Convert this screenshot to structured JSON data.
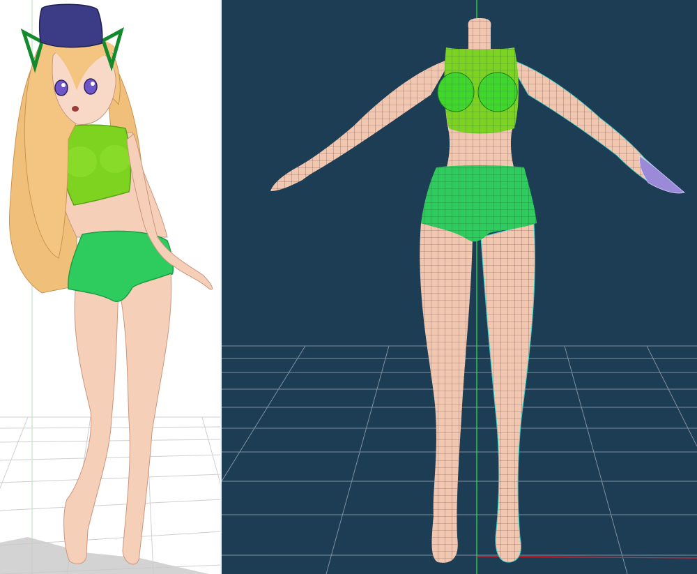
{
  "colors": {
    "left_background": "#ffffff",
    "viewport_background": "#1d3d55",
    "skin": "#f2c7b0",
    "top_green": "#7ed321",
    "shorts_green": "#2ecc5e",
    "hat_navy": "#3b3b86",
    "hair_blonde": "#f0c07a",
    "wireframe_cyan": "#2fd1c8",
    "grid_line": "#8a9aa6",
    "axis_green": "#2ee84a",
    "axis_red": "#d8283a"
  },
  "icons": {
    "left": "toon-shaded-character-render",
    "right": "wireframe-model-in-3d-viewport"
  }
}
